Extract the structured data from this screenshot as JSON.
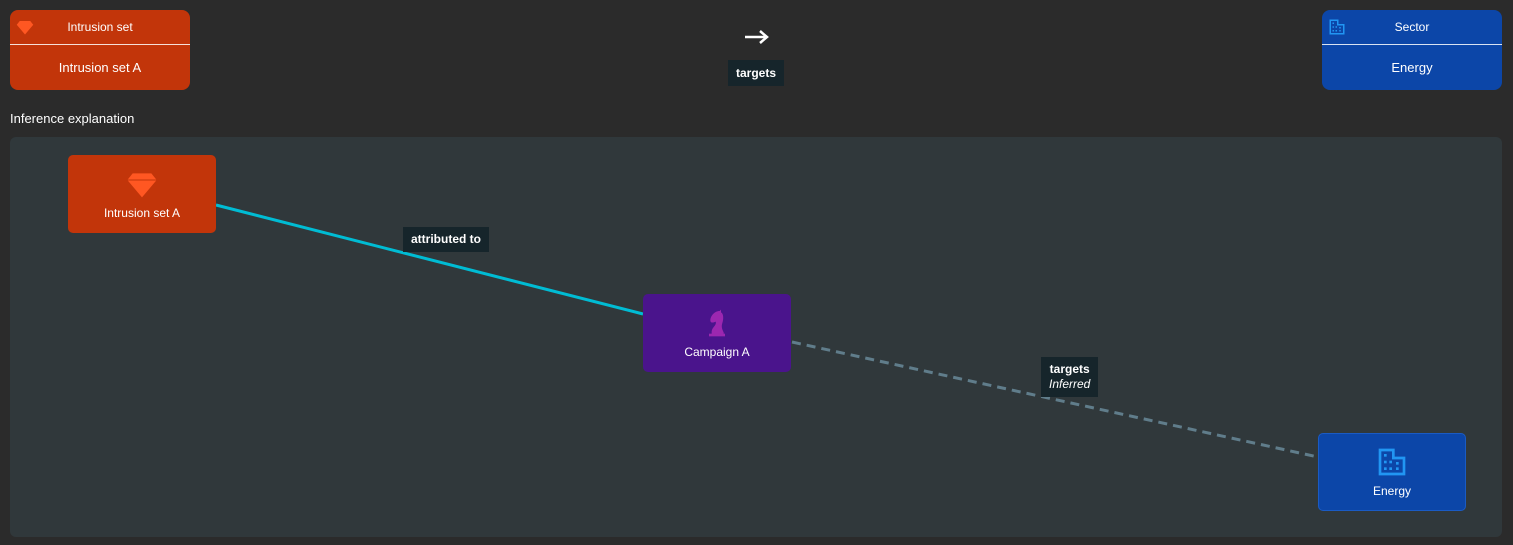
{
  "source_entity": {
    "type_label": "Intrusion set",
    "name": "Intrusion set A",
    "icon": "diamond-icon",
    "color": "#c2350a"
  },
  "relationship": {
    "arrow_icon": "arrow-right-icon",
    "label": "targets"
  },
  "target_entity": {
    "type_label": "Sector",
    "name": "Energy",
    "icon": "building-icon",
    "color": "#0c46a8"
  },
  "inference": {
    "title": "Inference explanation",
    "nodes": [
      {
        "name": "Intrusion set A",
        "icon": "diamond-icon",
        "color": "#c2350a"
      },
      {
        "name": "Campaign A",
        "icon": "chess-knight-icon",
        "color": "#4a148c"
      },
      {
        "name": "Energy",
        "icon": "building-icon",
        "color": "#0c46a8"
      }
    ],
    "edges": [
      {
        "label": "attributed to",
        "inferred_label": "",
        "color": "#00bcd4",
        "style": "solid"
      },
      {
        "label": "targets",
        "inferred_label": "Inferred",
        "color": "#607d8b",
        "style": "dashed"
      }
    ]
  }
}
